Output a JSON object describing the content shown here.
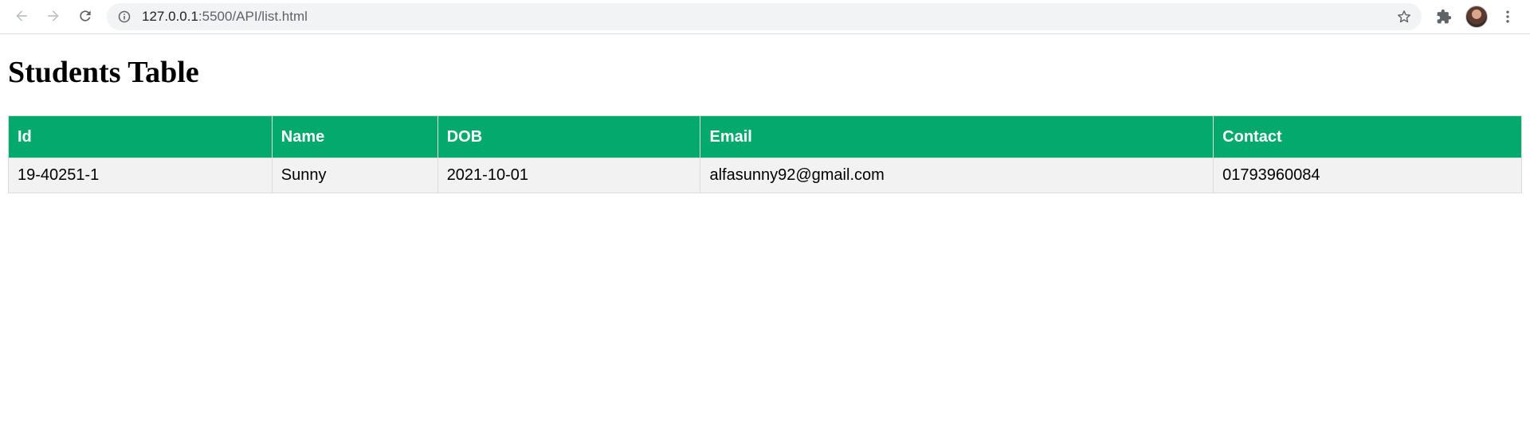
{
  "browser": {
    "url_host": "127.0.0.1",
    "url_rest": ":5500/API/list.html"
  },
  "page": {
    "title": "Students Table"
  },
  "table": {
    "headers": [
      "Id",
      "Name",
      "DOB",
      "Email",
      "Contact"
    ],
    "rows": [
      [
        "19-40251-1",
        "Sunny",
        "2021-10-01",
        "alfasunny92@gmail.com",
        "01793960084"
      ]
    ],
    "header_color": "#04aa6d",
    "row_color": "#f2f2f2"
  }
}
